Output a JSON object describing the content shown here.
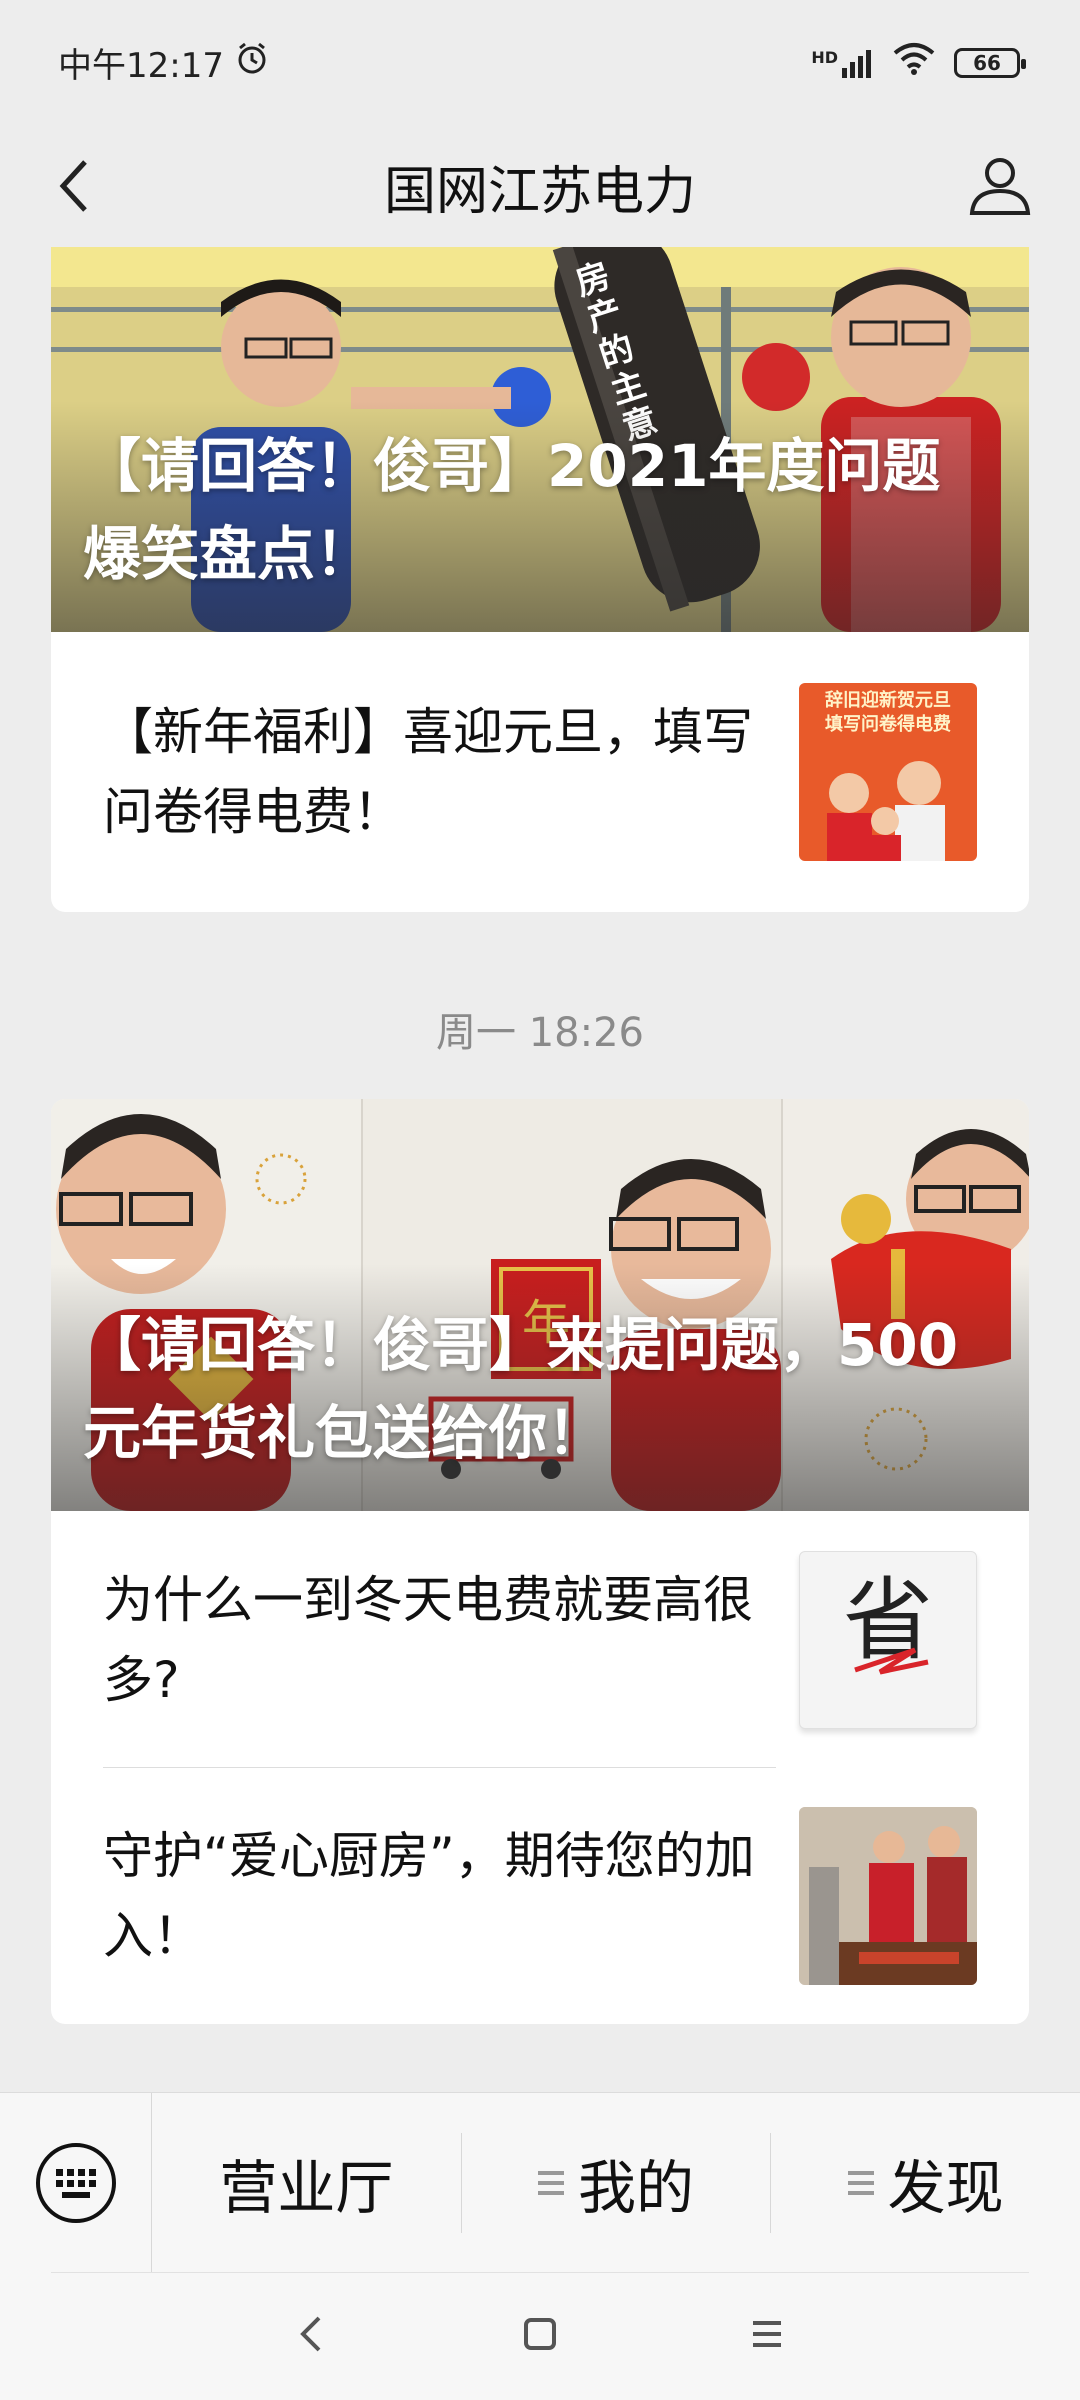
{
  "status_bar": {
    "time": "中午12:17",
    "network": "HD",
    "battery": "66"
  },
  "nav": {
    "title": "国网江苏电力"
  },
  "feed": {
    "group1": {
      "hero_title": "【请回答！俊哥】2021年度问题爆笑盘点！",
      "hero_caption": "房产的主意",
      "items": [
        {
          "title": "【新年福利】喜迎元旦，填写问卷得电费！",
          "thumb_text": "辞旧迎新贺元旦\n填写问卷得电费"
        }
      ]
    },
    "timestamp": "周一 18:26",
    "group2": {
      "hero_title": "【请回答！俊哥】来提问题，500元年货礼包送给你！",
      "hero_caption": "年",
      "items": [
        {
          "title": "为什么一到冬天电费就要高很多?",
          "thumb_text": "省"
        },
        {
          "title": "守护“爱心厨房”，期待您的加入！"
        }
      ]
    }
  },
  "menu": {
    "items": [
      {
        "label": "营业厅"
      },
      {
        "label": "我的"
      },
      {
        "label": "发现"
      }
    ]
  },
  "colors": {
    "background": "#ededed",
    "card": "#ffffff",
    "menu_bar": "#f7f7f7",
    "timestamp": "#8a8a8a"
  }
}
